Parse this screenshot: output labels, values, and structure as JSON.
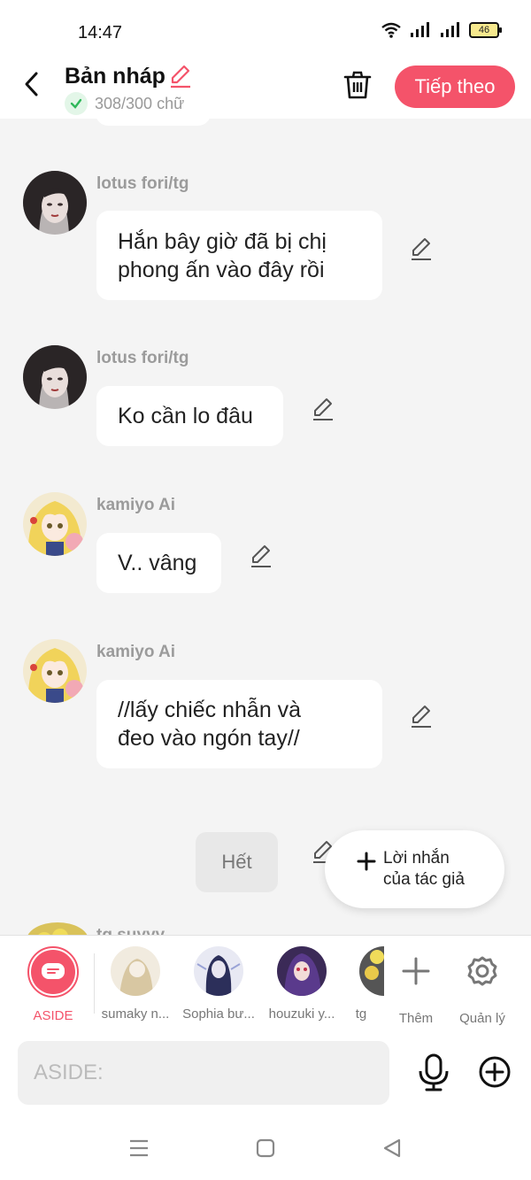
{
  "status": {
    "time": "14:47",
    "battery": "46"
  },
  "header": {
    "title": "Bản nháp",
    "counter": "308/300 chữ",
    "next_label": "Tiếp theo"
  },
  "messages": [
    {
      "name": "lotus fori/tg",
      "lines": [
        "Hắn bây giờ đã bị chị",
        "phong ấn vào đây rồi"
      ]
    },
    {
      "name": "lotus fori/tg",
      "lines": [
        "Ko cần lo đâu"
      ]
    },
    {
      "name": "kamiyo Ai",
      "lines": [
        "V.. vâng"
      ]
    },
    {
      "name": "kamiyo Ai",
      "lines": [
        "//lấy chiếc nhẫn và",
        "đeo vào ngón tay//"
      ]
    }
  ],
  "end_label": "Hết",
  "author_note": {
    "line1": "Lời nhắn",
    "line2": "của tác giả"
  },
  "peek_name": "tg suyyy",
  "characters": [
    {
      "label": "ASIDE",
      "color": "#f4536a"
    },
    {
      "label": "sumaky n..."
    },
    {
      "label": "Sophia bư..."
    },
    {
      "label": "houzuki y..."
    },
    {
      "label": "tg"
    }
  ],
  "tools": {
    "add_label": "Thêm",
    "manage_label": "Quản lý"
  },
  "input": {
    "placeholder": "ASIDE:"
  },
  "colors": {
    "accent": "#f4536a",
    "background": "#f4f4f4"
  }
}
